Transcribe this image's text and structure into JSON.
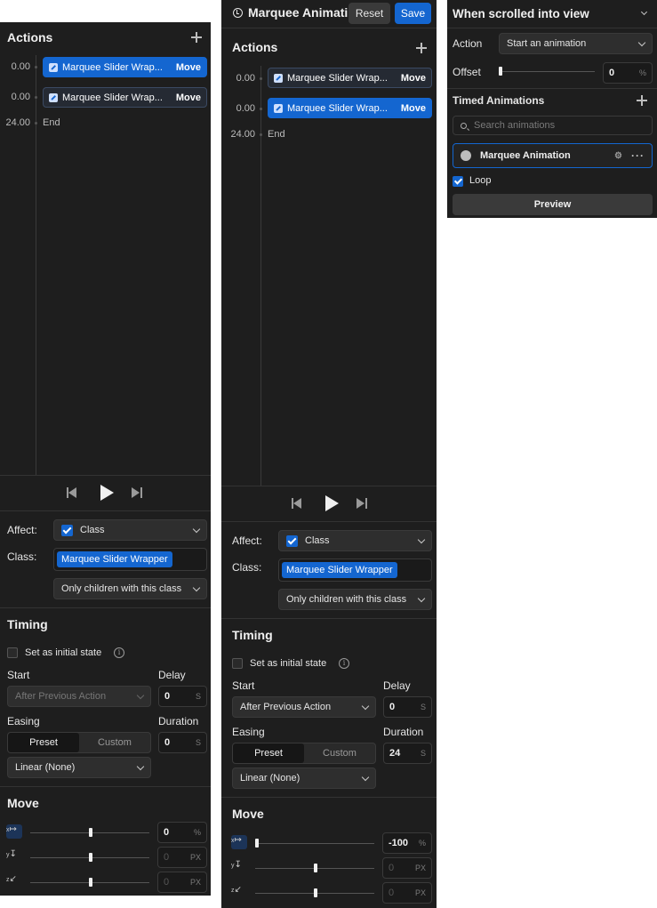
{
  "panel_a": {
    "actions_title": "Actions",
    "actions": [
      {
        "time": "0.00",
        "label": "Marquee Slider Wrap...",
        "type": "Move"
      },
      {
        "time": "0.00",
        "label": "Marquee Slider Wrap...",
        "type": "Move"
      }
    ],
    "end_time": "24.00",
    "end_label": "End",
    "affect_label": "Affect:",
    "affect_value": "Class",
    "class_label": "Class:",
    "class_tag": "Marquee Slider Wrapper",
    "scope_value": "Only children with this class",
    "timing_title": "Timing",
    "initial_state_label": "Set as initial state",
    "start_label": "Start",
    "start_value": "After Previous Action",
    "delay_label": "Delay",
    "delay_value": "0",
    "delay_unit": "S",
    "easing_label": "Easing",
    "preset_label": "Preset",
    "custom_label": "Custom",
    "duration_label": "Duration",
    "duration_value": "0",
    "duration_unit": "S",
    "easing_value": "Linear (None)",
    "move_title": "Move",
    "move": {
      "x": {
        "value": "0",
        "unit": "%"
      },
      "y": {
        "value": "0",
        "unit": "PX"
      },
      "z": {
        "value": "0",
        "unit": "PX"
      }
    }
  },
  "panel_b": {
    "title": "Marquee Animati...",
    "reset_label": "Reset",
    "save_label": "Save",
    "actions_title": "Actions",
    "actions": [
      {
        "time": "0.00",
        "label": "Marquee Slider Wrap...",
        "type": "Move"
      },
      {
        "time": "0.00",
        "label": "Marquee Slider Wrap...",
        "type": "Move"
      }
    ],
    "end_time": "24.00",
    "end_label": "End",
    "affect_label": "Affect:",
    "affect_value": "Class",
    "class_label": "Class:",
    "class_tag": "Marquee Slider Wrapper",
    "scope_value": "Only children with this class",
    "timing_title": "Timing",
    "initial_state_label": "Set as initial state",
    "start_label": "Start",
    "start_value": "After Previous Action",
    "delay_label": "Delay",
    "delay_value": "0",
    "delay_unit": "S",
    "easing_label": "Easing",
    "preset_label": "Preset",
    "custom_label": "Custom",
    "duration_label": "Duration",
    "duration_value": "24",
    "duration_unit": "S",
    "easing_value": "Linear (None)",
    "move_title": "Move",
    "move": {
      "x": {
        "value": "-100",
        "unit": "%"
      },
      "y": {
        "value": "0",
        "unit": "PX"
      },
      "z": {
        "value": "0",
        "unit": "PX"
      }
    }
  },
  "panel_c": {
    "trigger_title": "When scrolled into view",
    "action_label": "Action",
    "action_value": "Start an animation",
    "offset_label": "Offset",
    "offset_value": "0",
    "offset_unit": "%",
    "timed_title": "Timed Animations",
    "search_placeholder": "Search animations",
    "animation_name": "Marquee Animation",
    "loop_label": "Loop",
    "preview_label": "Preview"
  },
  "colors": {
    "accent": "#1466d0",
    "panel_bg": "#1e1e1e"
  }
}
